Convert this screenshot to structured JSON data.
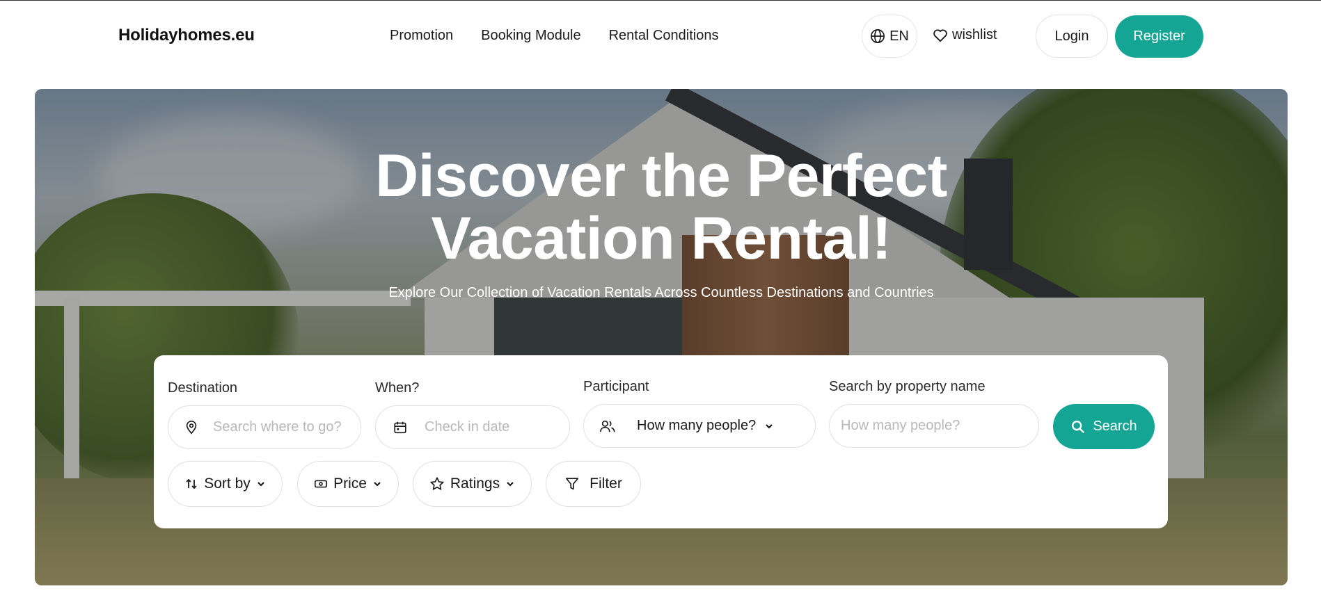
{
  "header": {
    "logo": "Holidayhomes.eu",
    "nav": [
      {
        "label": "Promotion"
      },
      {
        "label": "Booking Module"
      },
      {
        "label": "Rental Conditions"
      }
    ],
    "language": "EN",
    "wishlist": "wishlist",
    "login": "Login",
    "register": "Register"
  },
  "hero": {
    "title_line1": "Discover the Perfect",
    "title_line2": "Vacation Rental!",
    "subtitle": "Explore Our Collection of Vacation Rentals Across Countless Destinations and Countries"
  },
  "search": {
    "destination": {
      "label": "Destination",
      "placeholder": "Search where to go?",
      "icon": "map-pin-icon"
    },
    "when": {
      "label": "When?",
      "placeholder": "Check in date",
      "icon": "calendar-icon"
    },
    "participant": {
      "label": "Participant",
      "value": "How many people?",
      "icon": "users-icon"
    },
    "property": {
      "label": "Search by property name",
      "placeholder": "How many people?"
    },
    "search_button": "Search"
  },
  "filters": {
    "sort_by": "Sort by",
    "price": "Price",
    "ratings": "Ratings",
    "filter": "Filter"
  },
  "colors": {
    "accent": "#14a594"
  }
}
